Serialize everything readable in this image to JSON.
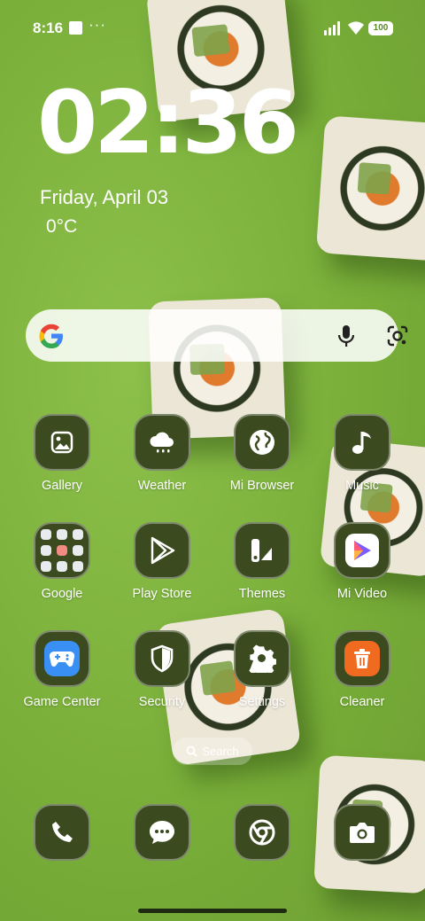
{
  "status_bar": {
    "time": "8:16",
    "dots": "···",
    "battery": "100"
  },
  "clock_widget": {
    "time": "02:36",
    "date": "Friday, April 03",
    "temperature": "0°C"
  },
  "search_widget": {
    "brand_icon": "google-g-icon",
    "mic_icon": "mic-icon",
    "lens_icon": "google-lens-icon"
  },
  "apps": [
    {
      "label": "Gallery",
      "icon": "gallery-icon"
    },
    {
      "label": "Weather",
      "icon": "weather-icon"
    },
    {
      "label": "Mi Browser",
      "icon": "globe-icon"
    },
    {
      "label": "Music",
      "icon": "music-note-icon"
    },
    {
      "label": "Google",
      "icon": "folder-icon"
    },
    {
      "label": "Play Store",
      "icon": "play-store-icon"
    },
    {
      "label": "Themes",
      "icon": "themes-icon"
    },
    {
      "label": "Mi Video",
      "icon": "mi-video-icon"
    },
    {
      "label": "Game Center",
      "icon": "gamepad-icon"
    },
    {
      "label": "Security",
      "icon": "shield-icon"
    },
    {
      "label": "Settings",
      "icon": "gear-icon"
    },
    {
      "label": "Cleaner",
      "icon": "trash-icon"
    }
  ],
  "page_search": {
    "label": "Search"
  },
  "dock": [
    {
      "icon": "phone-icon"
    },
    {
      "icon": "messages-icon"
    },
    {
      "icon": "chrome-icon"
    },
    {
      "icon": "camera-icon"
    }
  ],
  "colors": {
    "wallpaper": "#7fb43f",
    "icon_bg": "#3b4a1f"
  }
}
